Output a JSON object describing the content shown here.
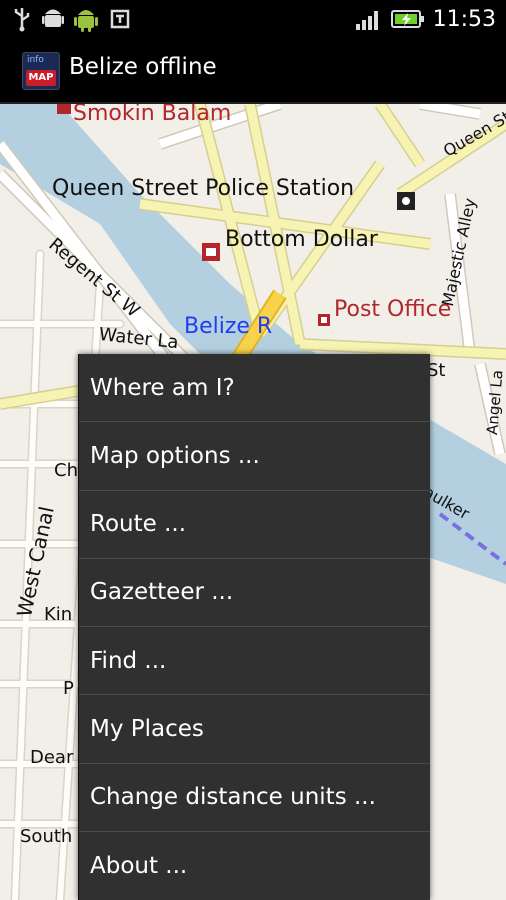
{
  "status_bar": {
    "time": "11:53",
    "icons": [
      "usb-icon",
      "android-debug-icon",
      "android-icon",
      "htc-sync-icon",
      "signal-icon",
      "battery-charging-icon"
    ]
  },
  "app": {
    "title": "Belize offline"
  },
  "map": {
    "labels": {
      "smokin_balam": "Smokin Balam",
      "police": "Queen Street Police Station",
      "bottom_dollar": "Bottom Dollar",
      "post_office": "Post Office",
      "belize_r": "Belize R",
      "regent": "Regent St W",
      "water": "Water La",
      "queen_st": "Queen St",
      "majestic": "Majestic Alley",
      "st_fragment": "St",
      "angel": "Angel La",
      "west_canal": "West Canal",
      "faulker": "aulker",
      "ch": "Ch",
      "kin": "Kin",
      "p": "P",
      "dear": "Dear",
      "south": "South"
    },
    "colors": {
      "land": "#f2efe9",
      "water": "#b4d0e0",
      "road_yellow": "#f7f3b3",
      "road_main": "#f8d24a",
      "label_red": "#b3262b",
      "label_blue": "#1f3ef2"
    }
  },
  "menu": {
    "items": [
      "Where am I?",
      "Map options ...",
      "Route ...",
      "Gazetteer ...",
      "Find ...",
      "My Places",
      "Change distance units ...",
      "About ..."
    ]
  }
}
